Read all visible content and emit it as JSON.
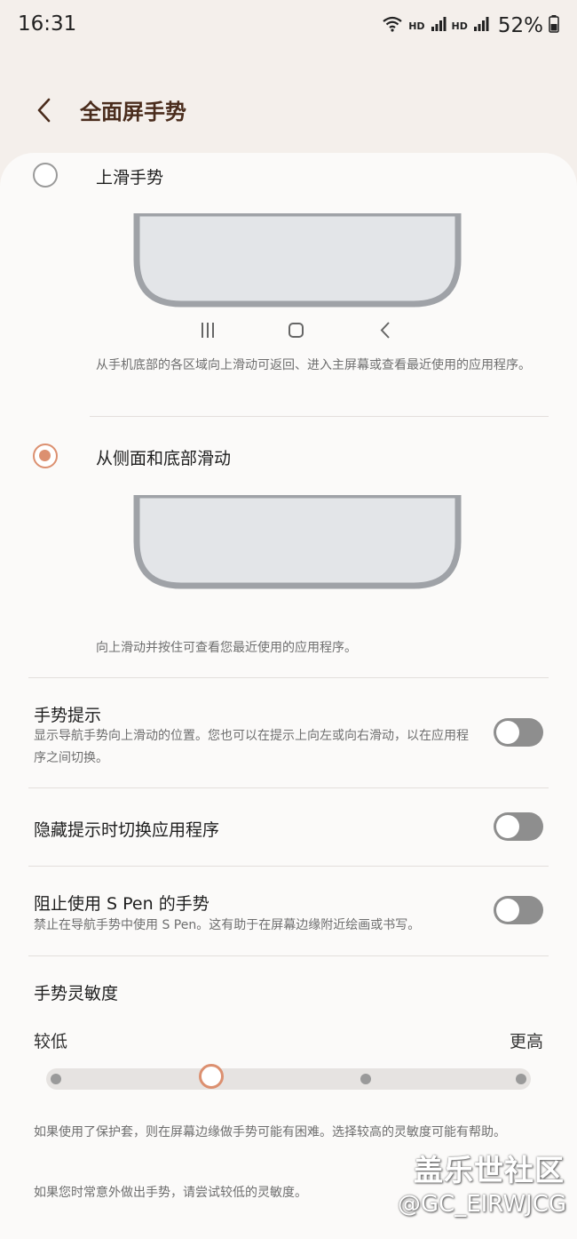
{
  "status_bar": {
    "time": "16:31",
    "hd1": "HD",
    "hd2": "HD",
    "battery": "52%"
  },
  "header": {
    "title": "全面屏手势"
  },
  "options": [
    {
      "label": "上滑手势",
      "description": "从手机底部的各区域向上滑动可返回、进入主屏幕或查看最近使用的应用程序。",
      "selected": false,
      "nav_icons": [
        "recents-icon",
        "home-icon",
        "back-icon"
      ]
    },
    {
      "label": "从侧面和底部滑动",
      "description": "向上滑动并按住可查看您最近使用的应用程序。",
      "selected": true
    }
  ],
  "settings": [
    {
      "title": "手势提示",
      "description": "显示导航手势向上滑动的位置。您也可以在提示上向左或向右滑动，以在应用程序之间切换。",
      "enabled": false
    },
    {
      "title": "隐藏提示时切换应用程序",
      "enabled": false
    },
    {
      "title": "阻止使用 S Pen 的手势",
      "description": "禁止在导航手势中使用 S Pen。这有助于在屏幕边缘附近绘画或书写。",
      "enabled": false
    }
  ],
  "sensitivity": {
    "title": "手势灵敏度",
    "low_label": "较低",
    "high_label": "更高",
    "steps": 4,
    "selected_step": 2
  },
  "footer": {
    "note1": "如果使用了保护套，则在屏幕边缘做手势可能有困难。选择较高的灵敏度可能有帮助。",
    "note2": "如果您时常意外做出手势，请尝试较低的灵敏度。"
  },
  "watermark": {
    "line1": "盖乐世社区",
    "line2": "@GC_EIRWJCG"
  },
  "colors": {
    "accent": "#dc9070",
    "title": "#4a2c1c",
    "background": "#f4efeb",
    "card": "#fbfaf9"
  }
}
